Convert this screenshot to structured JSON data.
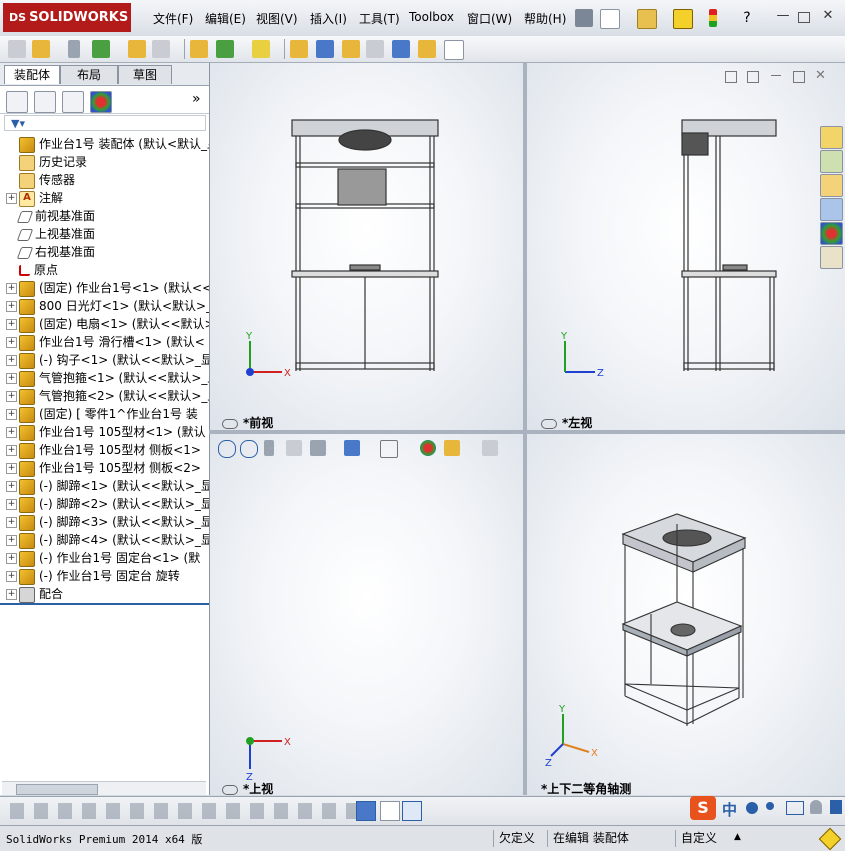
{
  "app": {
    "logo_prefix": "DS",
    "logo_text": "SOLIDWORKS"
  },
  "menu": [
    "文件(F)",
    "编辑(E)",
    "视图(V)",
    "插入(I)",
    "工具(T)",
    "Toolbox",
    "窗口(W)",
    "帮助(H)"
  ],
  "left_panel": {
    "tabs": [
      "装配体",
      "布局",
      "草图"
    ],
    "expand_glyph": "»",
    "tree": [
      {
        "label": "作业台1号  装配体  (默认<默认_显",
        "icon": "assembly-icon",
        "expand": false
      },
      {
        "label": "历史记录",
        "icon": "history-icon",
        "expand": false
      },
      {
        "label": "传感器",
        "icon": "sensor-icon",
        "expand": false
      },
      {
        "label": "注解",
        "icon": "annotation-icon",
        "expand": true
      },
      {
        "label": "前视基准面",
        "icon": "plane-icon",
        "expand": false
      },
      {
        "label": "上视基准面",
        "icon": "plane-icon",
        "expand": false
      },
      {
        "label": "右视基准面",
        "icon": "plane-icon",
        "expand": false
      },
      {
        "label": "原点",
        "icon": "origin-icon",
        "expand": false
      },
      {
        "label": "(固定) 作业台1号<1> (默认<<",
        "icon": "assembly-icon",
        "expand": true
      },
      {
        "label": "800 日光灯<1> (默认<默认>_显",
        "icon": "assembly-icon",
        "expand": true
      },
      {
        "label": "(固定) 电扇<1> (默认<<默认>_",
        "icon": "assembly-icon",
        "expand": true
      },
      {
        "label": "作业台1号  滑行槽<1> (默认<",
        "icon": "assembly-icon",
        "expand": true
      },
      {
        "label": "(-) 钩子<1> (默认<<默认>_显示",
        "icon": "assembly-icon",
        "expand": true
      },
      {
        "label": "气管抱箍<1> (默认<<默认>_显示",
        "icon": "assembly-icon",
        "expand": true
      },
      {
        "label": "气管抱箍<2> (默认<<默认>_显示",
        "icon": "assembly-icon",
        "expand": true
      },
      {
        "label": "(固定) [ 零件1^作业台1号  装",
        "icon": "assembly-icon",
        "expand": true
      },
      {
        "label": "作业台1号  105型材<1> (默认",
        "icon": "assembly-icon",
        "expand": true
      },
      {
        "label": "作业台1号  105型材  侧板<1>",
        "icon": "assembly-icon",
        "expand": true
      },
      {
        "label": "作业台1号  105型材  侧板<2>",
        "icon": "assembly-icon",
        "expand": true
      },
      {
        "label": "(-) 脚蹄<1> (默认<<默认>_显示",
        "icon": "assembly-icon",
        "expand": true
      },
      {
        "label": "(-) 脚蹄<2> (默认<<默认>_显示",
        "icon": "assembly-icon",
        "expand": true
      },
      {
        "label": "(-) 脚蹄<3> (默认<<默认>_显示",
        "icon": "assembly-icon",
        "expand": true
      },
      {
        "label": "(-) 脚蹄<4> (默认<<默认>_显示",
        "icon": "assembly-icon",
        "expand": true
      },
      {
        "label": "(-) 作业台1号  固定台<1> (默",
        "icon": "assembly-icon",
        "expand": true
      },
      {
        "label": "(-) 作业台1号  固定台  旋转",
        "icon": "assembly-icon",
        "expand": true
      },
      {
        "label": "配合",
        "icon": "mates-icon",
        "expand": true
      }
    ]
  },
  "viewports": {
    "front": {
      "label": "*前视",
      "axes": [
        "Y",
        "X"
      ]
    },
    "left": {
      "label": "*左视",
      "axes": [
        "Y",
        "Z"
      ]
    },
    "top": {
      "label": "*上视",
      "axes": [
        "X",
        "Z"
      ]
    },
    "iso": {
      "label": "*上下二等角轴测",
      "axes": [
        "Y",
        "X",
        "Z"
      ]
    }
  },
  "status": {
    "version": "SolidWorks Premium 2014 x64 版",
    "cell1": "欠定义",
    "cell2": "在编辑 装配体",
    "cell3": "自定义",
    "caret": "▲"
  },
  "ime": {
    "logo": "S",
    "mode": "中"
  },
  "colors": {
    "accent": "#2b5fa8",
    "logo": "#b31b1b",
    "axis_x": "#d02020",
    "axis_y": "#20a020",
    "axis_z": "#2040d0"
  }
}
